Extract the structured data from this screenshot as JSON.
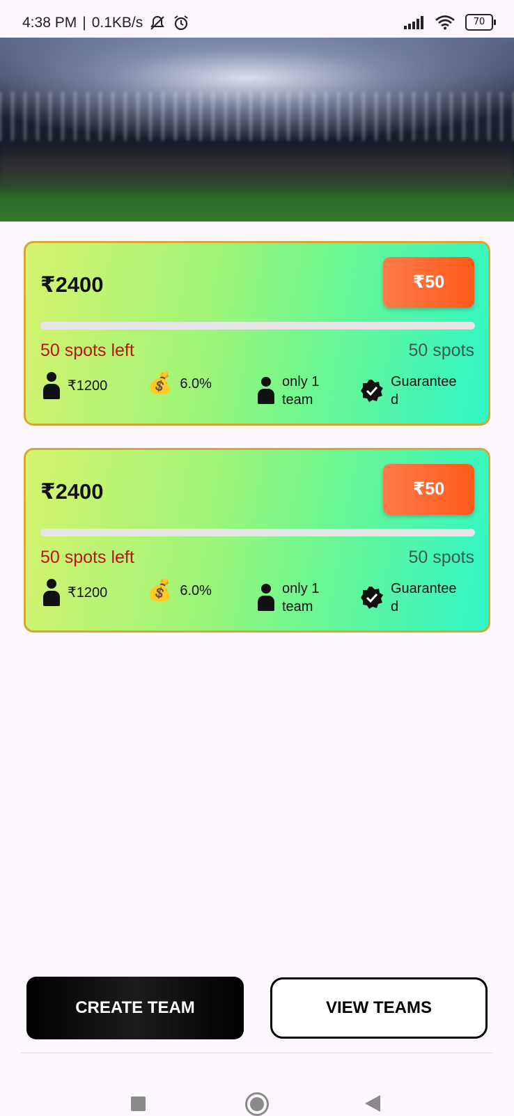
{
  "status_bar": {
    "time": "4:38 PM",
    "network_speed": "0.1KB/s",
    "battery": "70",
    "icons": [
      "bell-muted-icon",
      "alarm-icon",
      "signal-icon",
      "wifi-icon",
      "battery-icon"
    ]
  },
  "hero": {
    "image": "stadium-banner"
  },
  "contests": [
    {
      "prize": "₹2400",
      "entry_fee": "₹50",
      "fill_fraction": 0.0,
      "spots_left": "50 spots left",
      "total_spots": "50 spots",
      "first_prize": "₹1200",
      "winners_pct": "6.0%",
      "team_limit": "only 1 team",
      "guaranteed": "Guaranteed"
    },
    {
      "prize": "₹2400",
      "entry_fee": "₹50",
      "fill_fraction": 0.0,
      "spots_left": "50 spots left",
      "total_spots": "50 spots",
      "first_prize": "₹1200",
      "winners_pct": "6.0%",
      "team_limit": "only 1 team",
      "guaranteed": "Guaranteed"
    }
  ],
  "actions": {
    "create_team": "CREATE TEAM",
    "view_teams": "VIEW TEAMS"
  },
  "colors": {
    "spots_left": "#b81515",
    "card_border": "#d4a832",
    "fee_button": "#ff5a1a"
  }
}
